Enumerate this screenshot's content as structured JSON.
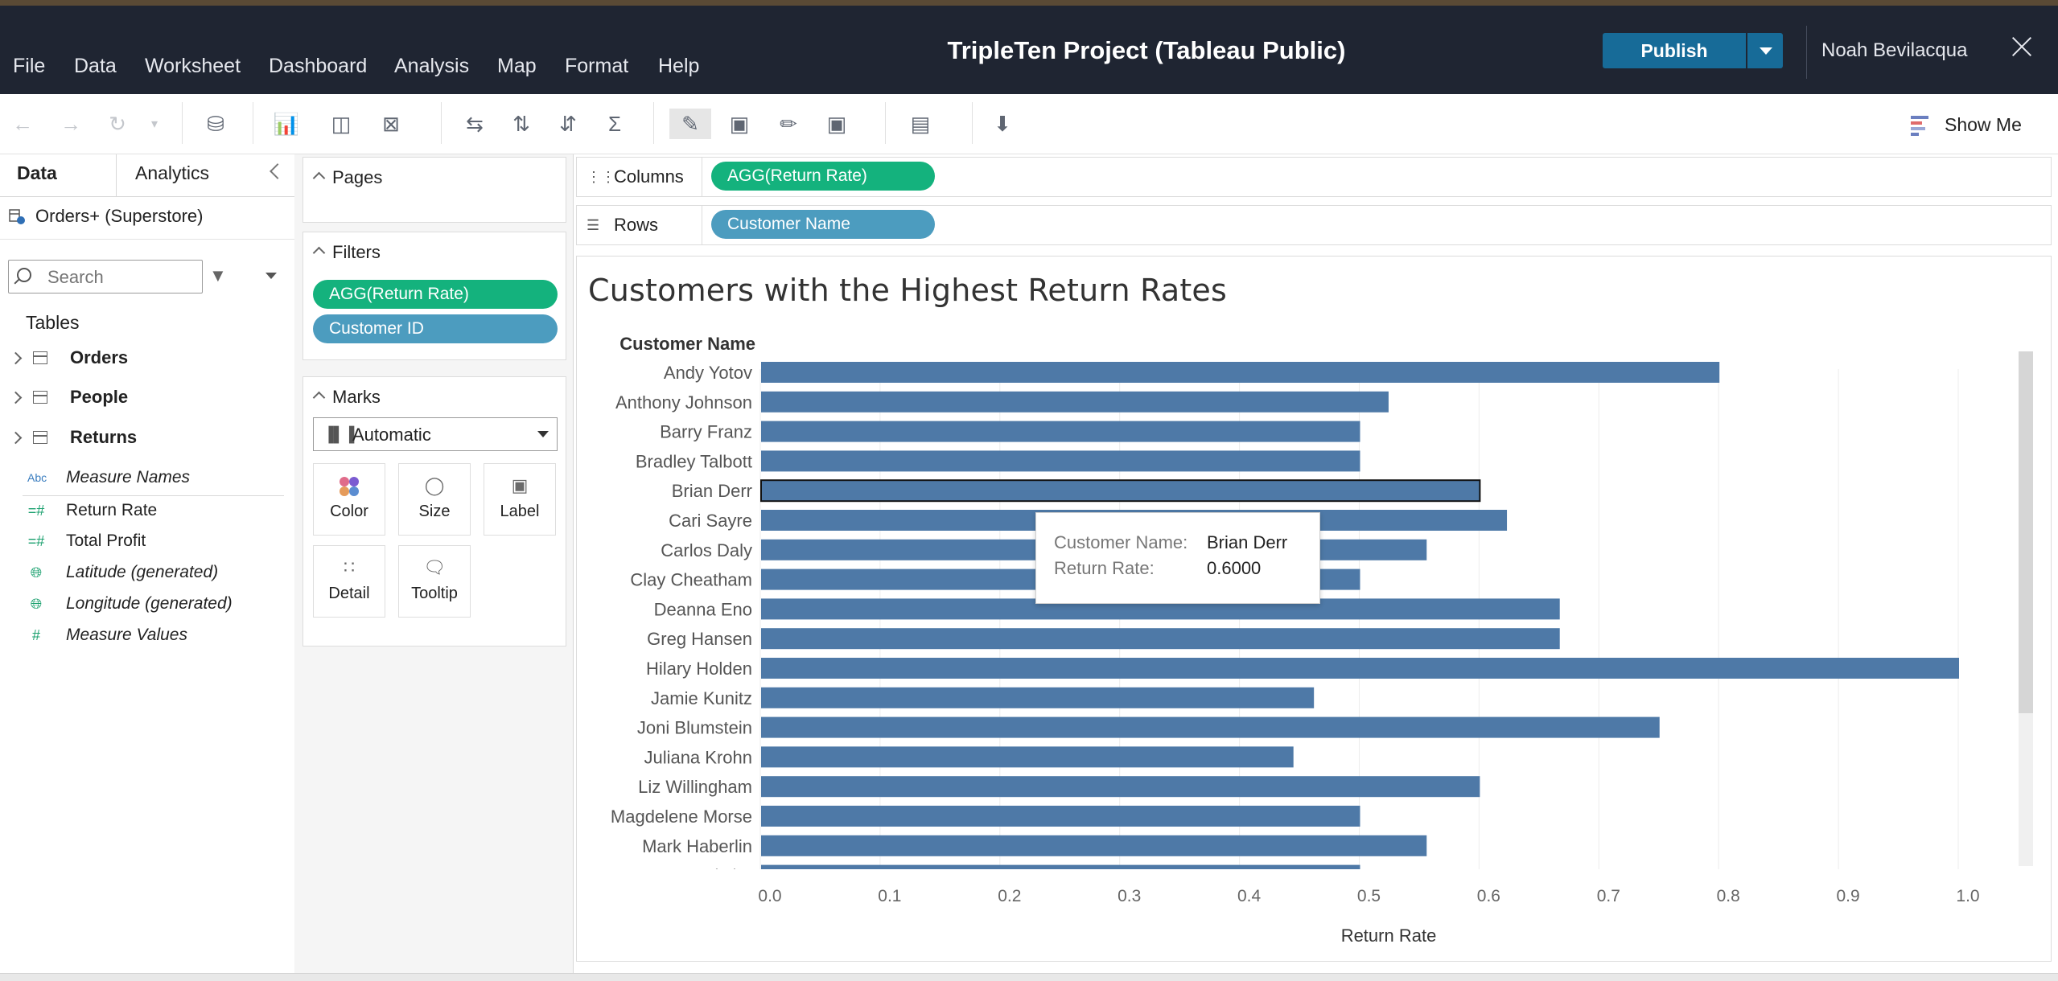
{
  "app": {
    "title": "TripleTen Project (Tableau Public)",
    "publish_label": "Publish",
    "user": "Noah Bevilacqua",
    "menu": [
      "File",
      "Data",
      "Worksheet",
      "Dashboard",
      "Analysis",
      "Map",
      "Format",
      "Help"
    ]
  },
  "toolbar": {
    "show_me_label": "Show Me"
  },
  "left_pane": {
    "tabs": [
      "Data",
      "Analytics"
    ],
    "datasource": "Orders+ (Superstore)",
    "search_placeholder": "Search",
    "tables_heading": "Tables",
    "tables": [
      "Orders",
      "People",
      "Returns"
    ],
    "fields": [
      {
        "label": "Measure Names",
        "icon": "Abc",
        "italic": true
      },
      {
        "label": "Return Rate",
        "icon": "#",
        "italic": false
      },
      {
        "label": "Total Profit",
        "icon": "#",
        "italic": false
      },
      {
        "label": "Latitude (generated)",
        "icon": "globe",
        "italic": true
      },
      {
        "label": "Longitude (generated)",
        "icon": "globe",
        "italic": true
      },
      {
        "label": "Measure Values",
        "icon": "#",
        "italic": true
      }
    ]
  },
  "shelves": {
    "pages_label": "Pages",
    "filters_label": "Filters",
    "filters": [
      "AGG(Return Rate)",
      "Customer ID"
    ],
    "marks_label": "Marks",
    "marks_type": "Automatic",
    "mark_buttons": [
      "Color",
      "Size",
      "Label",
      "Detail",
      "Tooltip"
    ],
    "columns_label": "Columns",
    "columns_pill": "AGG(Return Rate)",
    "rows_label": "Rows",
    "rows_pill": "Customer Name"
  },
  "colors": {
    "bar": "#4e79a7",
    "green_pill": "#14b27d",
    "blue_pill": "#4c9cbf",
    "publish": "#176b98",
    "topbar": "#1f2532"
  },
  "chart_data": {
    "type": "bar",
    "orientation": "horizontal",
    "title": "Customers with the Highest Return Rates",
    "ylabel": "Customer Name",
    "xlabel": "Return Rate",
    "xlim": [
      0,
      1.05
    ],
    "xticks": [
      "0.0",
      "0.1",
      "0.2",
      "0.3",
      "0.4",
      "0.5",
      "0.6",
      "0.7",
      "0.8",
      "0.9",
      "1.0"
    ],
    "grid": "vertical",
    "categories": [
      "Andy Yotov",
      "Anthony Johnson",
      "Barry Franz",
      "Bradley Talbott",
      "Brian Derr",
      "Cari Sayre",
      "Carlos Daly",
      "Clay Cheatham",
      "Deanna Eno",
      "Greg Hansen",
      "Hilary Holden",
      "Jamie Kunitz",
      "Joni Blumstein",
      "Juliana Krohn",
      "Liz Willingham",
      "Magdelene Morse",
      "Mark Haberlin",
      "Maureen Fritzler"
    ],
    "values": [
      0.8,
      0.5238,
      0.5,
      0.5,
      0.6,
      0.6226,
      0.5556,
      0.5,
      0.6667,
      0.6667,
      1.0,
      0.4615,
      0.75,
      0.4444,
      0.6,
      0.5,
      0.5556,
      0.5
    ],
    "selected": "Brian Derr"
  },
  "tooltip": {
    "name_key": "Customer Name:",
    "name_val": "Brian Derr",
    "rate_key": "Return Rate:",
    "rate_val": "0.6000"
  }
}
